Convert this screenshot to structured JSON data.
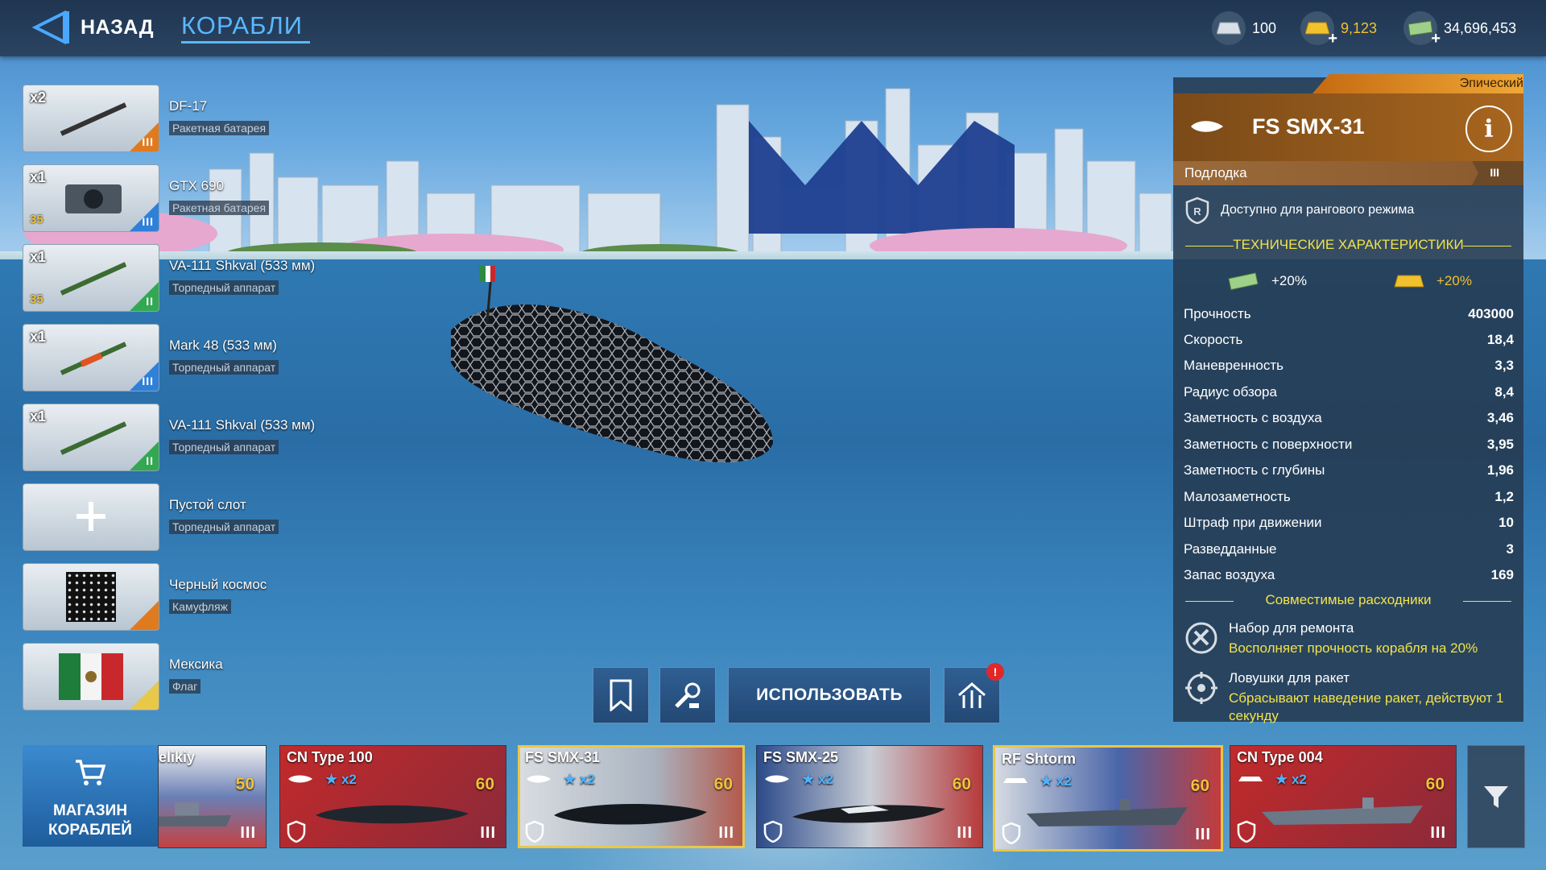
{
  "header": {
    "back_label": "НАЗАД",
    "title": "КОРАБЛИ",
    "currencies": [
      {
        "icon": "silver-bar-icon",
        "value": "100"
      },
      {
        "icon": "gold-bar-icon",
        "value": "9,123"
      },
      {
        "icon": "cash-icon",
        "value": "34,696,453"
      }
    ]
  },
  "slots": [
    {
      "qty": "x2",
      "name": "DF-17",
      "type": "Ракетная батарея",
      "level": "",
      "tier": "III",
      "color": "#e07a1f"
    },
    {
      "qty": "x1",
      "name": "GTX 690",
      "type": "Ракетная батарея",
      "level": "35",
      "tier": "III",
      "color": "#2f80d8"
    },
    {
      "qty": "x1",
      "name": "VA-111 Shkval (533 мм)",
      "type": "Торпедный аппарат",
      "level": "35",
      "tier": "II",
      "color": "#32a852"
    },
    {
      "qty": "x1",
      "name": "Mark 48 (533 мм)",
      "type": "Торпедный аппарат",
      "level": "",
      "tier": "III",
      "color": "#2f80d8"
    },
    {
      "qty": "x1",
      "name": "VA-111 Shkval (533 мм)",
      "type": "Торпедный аппарат",
      "level": "",
      "tier": "II",
      "color": "#32a852"
    },
    {
      "qty": "",
      "name": "Пустой слот",
      "type": "Торпедный аппарат",
      "level": "",
      "tier": "",
      "color": ""
    },
    {
      "qty": "",
      "name": "Черный космос",
      "type": "Камуфляж",
      "level": "",
      "tier": "",
      "color": "#e07a1f"
    },
    {
      "qty": "",
      "name": "Мексика",
      "type": "Флаг",
      "level": "",
      "tier": "",
      "color": "#e8c848"
    }
  ],
  "panel": {
    "rarity": "Эпический",
    "ship_name": "FS SMX-31",
    "ship_class": "Подлодка",
    "tier": "III",
    "ranked_text": "Доступно для рангового режима",
    "tech_title": "ТЕХНИЧЕСКИЕ ХАРАКТЕРИСТИКИ",
    "bonus_cash": "+20%",
    "bonus_gold": "+20%",
    "stats": [
      {
        "label": "Прочность",
        "value": "403000"
      },
      {
        "label": "Скорость",
        "value": "18,4"
      },
      {
        "label": "Маневренность",
        "value": "3,3"
      },
      {
        "label": "Радиус обзора",
        "value": "8,4"
      },
      {
        "label": "Заметность с воздуха",
        "value": "3,46"
      },
      {
        "label": "Заметность с поверхности",
        "value": "3,95"
      },
      {
        "label": "Заметность с глубины",
        "value": "1,96"
      },
      {
        "label": "Малозаметность",
        "value": "1,2"
      },
      {
        "label": "Штраф при движении",
        "value": "10"
      },
      {
        "label": "Разведданные",
        "value": "3"
      },
      {
        "label": "Запас воздуха",
        "value": "169"
      }
    ],
    "consumables_title": "Совместимые расходники",
    "consumables": [
      {
        "title": "Набор для ремонта",
        "desc": "Восполняет прочность корабля на 20%"
      },
      {
        "title": "Ловушки для ракет",
        "desc": "Сбрасывают наведение ракет, действуют 1 секунду"
      }
    ]
  },
  "actions": {
    "use_label": "ИСПОЛЬЗОВАТЬ",
    "badge": "!"
  },
  "shop": {
    "line1": "МАГАЗИН",
    "line2": "КОРАБЛЕЙ"
  },
  "ships": [
    {
      "name": "elikiy",
      "stars": "",
      "level": "50",
      "tier": "III",
      "flag": "ru"
    },
    {
      "name": "CN Type 100",
      "stars": "x2",
      "level": "60",
      "tier": "III",
      "flag": "cn"
    },
    {
      "name": "FS SMX-31",
      "stars": "x2",
      "level": "60",
      "tier": "III",
      "flag": "fr"
    },
    {
      "name": "FS SMX-25",
      "stars": "x2",
      "level": "60",
      "tier": "III",
      "flag": "fr"
    },
    {
      "name": "RF Shtorm",
      "stars": "x2",
      "level": "60",
      "tier": "III",
      "flag": "ru"
    },
    {
      "name": "CN Type 004",
      "stars": "x2",
      "level": "60",
      "tier": "III",
      "flag": "cn"
    }
  ]
}
